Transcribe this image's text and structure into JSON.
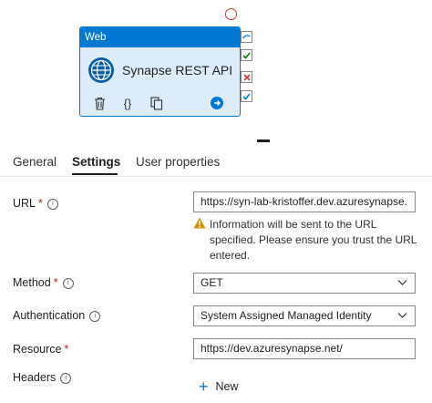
{
  "activity": {
    "type_label": "Web",
    "name": "Synapse REST API",
    "icons": [
      "globe-icon",
      "delete-icon",
      "code-icon",
      "copy-icon",
      "go-arrow-icon"
    ]
  },
  "ports": [
    "skip-icon",
    "success-check-icon",
    "failure-x-icon",
    "completion-check-icon"
  ],
  "tabs": [
    {
      "label": "General",
      "active": false
    },
    {
      "label": "Settings",
      "active": true
    },
    {
      "label": "User properties",
      "active": false
    }
  ],
  "form": {
    "url": {
      "label": "URL",
      "required": "*",
      "value": "https://syn-lab-kristoffer.dev.azuresynapse.",
      "warning": "Information will be sent to the URL specified. Please ensure you trust the URL entered."
    },
    "method": {
      "label": "Method",
      "required": "*",
      "value": "GET"
    },
    "authentication": {
      "label": "Authentication",
      "value": "System Assigned Managed Identity"
    },
    "resource": {
      "label": "Resource",
      "required": "*",
      "value": "https://dev.azuresynapse.net/"
    },
    "headers": {
      "label": "Headers",
      "new_label": "New"
    }
  },
  "colors": {
    "accent": "#0078d4",
    "activity_bg": "#dcecfa",
    "success": "#107c10",
    "failure": "#d13438",
    "warning": "#d29200"
  }
}
